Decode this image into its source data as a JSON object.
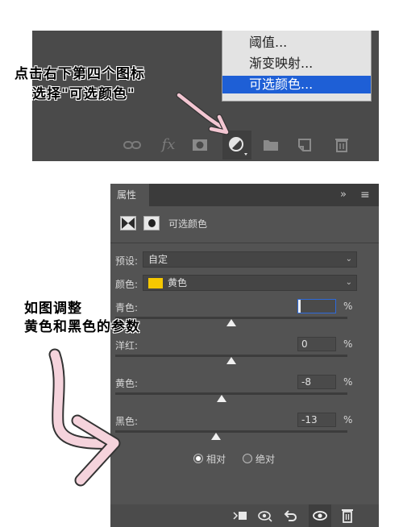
{
  "top": {
    "menu_items": [
      "阈值...",
      "渐变映射...",
      "可选颜色..."
    ],
    "selected_menu_item": "可选颜色...",
    "toolbar_icons": [
      "link-icon",
      "fx-icon",
      "mask-icon",
      "adjustment-layer-icon",
      "folder-icon",
      "new-layer-icon",
      "trash-icon"
    ]
  },
  "notes": {
    "top_line1": "点击右下第四个图标",
    "top_line2": "选择\"可选颜色\"",
    "bottom_line1": "如图调整",
    "bottom_line2": "黄色和黑色的参数"
  },
  "panel": {
    "tab_label": "属性",
    "collapse_glyph": "»",
    "menu_glyph": "≡",
    "layer_title": "可选颜色",
    "preset_label": "预设:",
    "preset_value": "自定",
    "colors_label": "颜色:",
    "colors_value": "黄色",
    "swatch_color": "#f6c800",
    "sliders": [
      {
        "label": "青色:",
        "value": "",
        "percent": "%"
      },
      {
        "label": "洋红:",
        "value": "0",
        "percent": "%"
      },
      {
        "label": "黄色:",
        "value": "-8",
        "percent": "%"
      },
      {
        "label": "黑色:",
        "value": "-13",
        "percent": "%"
      }
    ],
    "slider_levels": [
      0,
      0,
      -8,
      -13
    ],
    "method_relative": "相对",
    "method_absolute": "绝对",
    "method_selected": "相对",
    "bottom_icons": [
      "clip-to-layer-icon",
      "view-previous-icon",
      "reset-icon",
      "visibility-icon",
      "delete-icon"
    ]
  },
  "colors": {
    "selection_blue": "#1e5fd6",
    "panel_bg": "#535353",
    "annotation_arrow": "#f3c6d2"
  }
}
